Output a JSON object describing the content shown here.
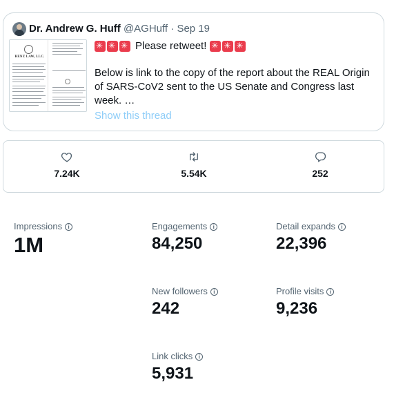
{
  "tweet": {
    "author_name": "Dr. Andrew G. Huff",
    "author_handle": "@AGHuff",
    "separator": "·",
    "date": "Sep 19",
    "retweet_text": "Please retweet!",
    "body_text": "Below is link to the copy of the report about the REAL Origin of SARS-CoV2 sent to the US Senate and Congress last week. …",
    "show_thread": "Show this thread",
    "attachment": {
      "firm_name": "RENZ LAW, LLC."
    },
    "siren_icon": "police-car-light-emoji",
    "accent_color": "#1d9bf0"
  },
  "stats": {
    "likes": "7.24K",
    "retweets": "5.54K",
    "replies": "252",
    "icons": [
      "heart-icon",
      "retweet-icon",
      "reply-icon"
    ]
  },
  "metrics": {
    "impressions": {
      "label": "Impressions",
      "value": "1M"
    },
    "engagements": {
      "label": "Engagements",
      "value": "84,250"
    },
    "detail_expands": {
      "label": "Detail expands",
      "value": "22,396"
    },
    "new_followers": {
      "label": "New followers",
      "value": "242"
    },
    "profile_visits": {
      "label": "Profile visits",
      "value": "9,236"
    },
    "link_clicks": {
      "label": "Link clicks",
      "value": "5,931"
    },
    "info_icon": "info-circle-icon"
  }
}
